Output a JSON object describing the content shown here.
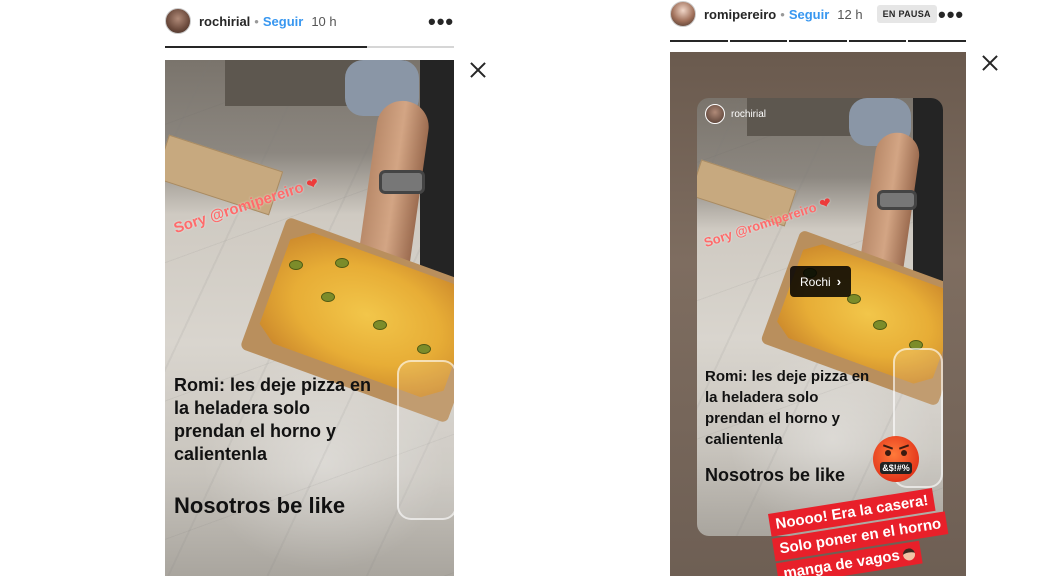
{
  "left_story": {
    "username": "rochirial",
    "follow_label": "Seguir",
    "separator": "•",
    "time": "10 h",
    "progress": 0.7,
    "more_label": "•••",
    "mention": "Sory @romipereiro",
    "caption_lines": [
      "Romi: les deje pizza en",
      "la heladera solo",
      "prendan el horno y",
      "calientenla"
    ],
    "caption2": "Nosotros be like"
  },
  "right_story": {
    "username": "romipereiro",
    "follow_label": "Seguir",
    "separator": "•",
    "time": "12 h",
    "paused_badge": "EN PAUSA",
    "more_label": "•••",
    "progress_segments": 5,
    "reposted_user": "rochirial",
    "mention": "Sory @romipereiro",
    "user_tag": "Rochi",
    "caption_lines": [
      "Romi: les deje pizza en",
      "la heladera solo",
      "prendan el horno y",
      "calientenla"
    ],
    "caption2": "Nosotros be like",
    "emoji_text": "&$!#%",
    "sticker_lines": [
      "Noooo! Era la casera!",
      "Solo poner en el horno",
      "manga de vagos"
    ]
  },
  "icons": {
    "close": "close-icon",
    "more": "more-options-icon",
    "heart": "heart-icon",
    "angry_face": "angry-face-emoji",
    "chevron": "chevron-right-icon"
  },
  "colors": {
    "follow": "#3897f0",
    "mention": "#ff6b6b",
    "sticker": "#e8202a"
  }
}
